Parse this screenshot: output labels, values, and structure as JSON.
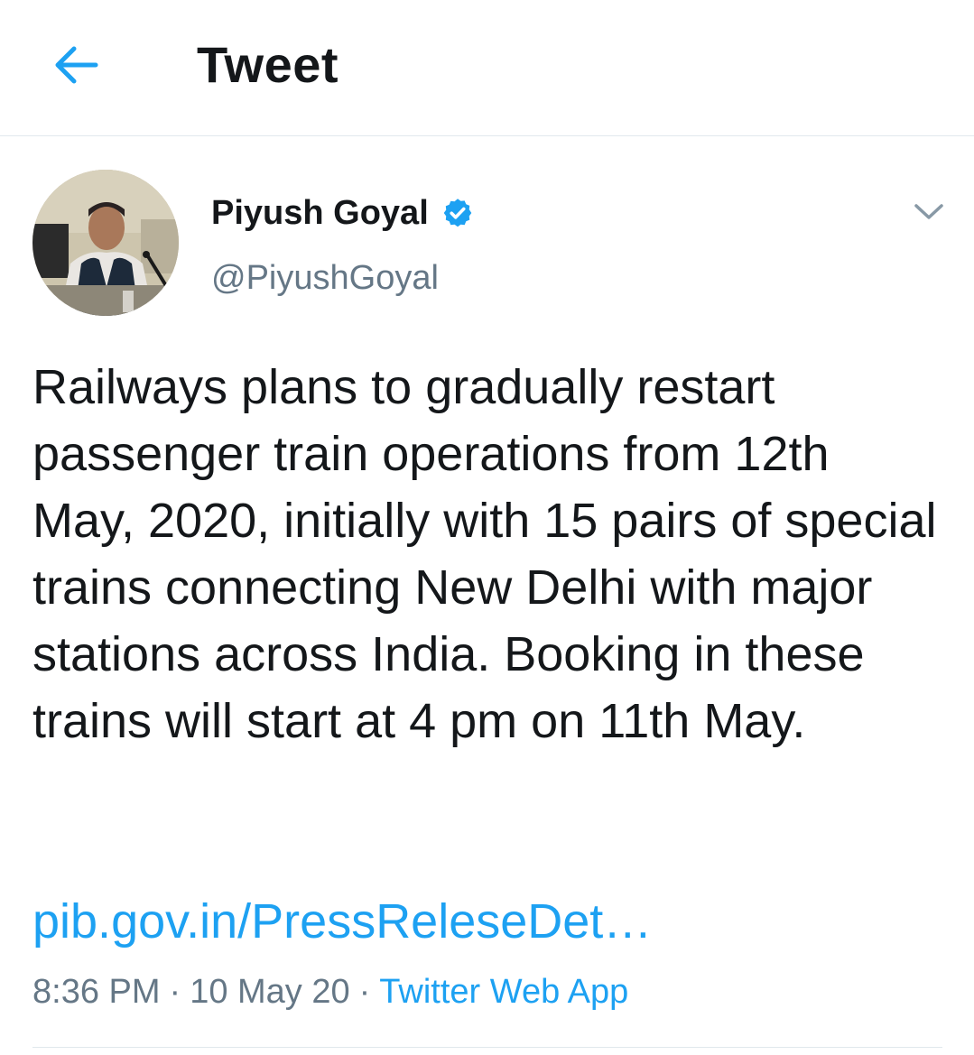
{
  "header": {
    "title": "Tweet"
  },
  "author": {
    "display_name": "Piyush Goyal",
    "handle": "@PiyushGoyal",
    "verified": true
  },
  "tweet": {
    "text": "Railways plans to gradually restart passenger train operations from 12th May, 2020, initially with 15 pairs of special trains connecting New Delhi with major stations across India. Booking in these trains will start at 4 pm on 11th May.",
    "link_text": "pib.gov.in/PressReleseDet…"
  },
  "meta": {
    "time": "8:36 PM",
    "separator": "·",
    "date": "10 May 20",
    "source": "Twitter Web App"
  },
  "colors": {
    "accent": "#1da1f2",
    "text": "#14171a",
    "secondary": "#657786",
    "divider": "#e1e8ed"
  },
  "icons": {
    "back": "arrow-left-icon",
    "verified": "verified-badge-icon",
    "more": "chevron-down-icon"
  }
}
